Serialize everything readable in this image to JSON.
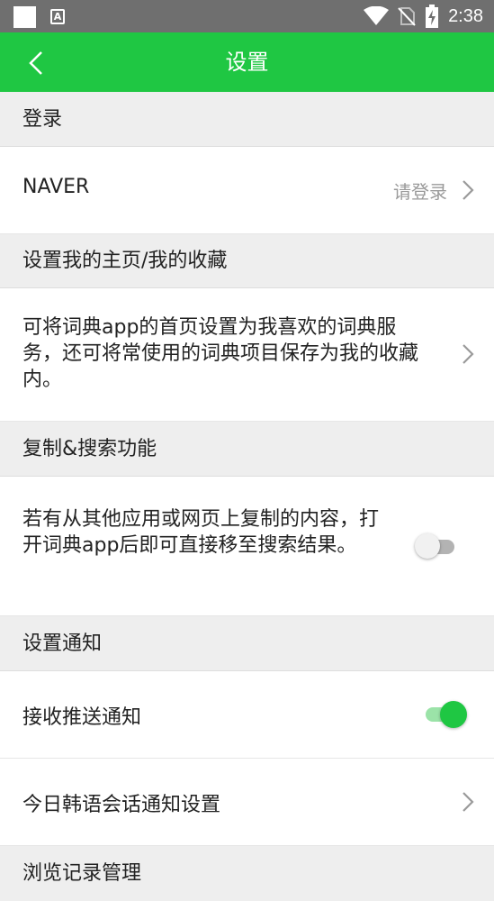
{
  "status_bar": {
    "time": "2:38",
    "icons": [
      "notification-square-icon",
      "a-icon",
      "wifi-icon",
      "no-sim-icon",
      "battery-charging-icon"
    ]
  },
  "app_bar": {
    "title": "设置",
    "back_icon": "chevron-left-icon",
    "color": "#1fc743"
  },
  "sections": {
    "login": {
      "header": "登录",
      "naver_label": "NAVER",
      "naver_value": "请登录"
    },
    "homepage": {
      "header": "设置我的主页/我的收藏",
      "description": "可将词典app的首页设置为我喜欢的词典服务，还可将常使用的词典项目保存为我的收藏内。"
    },
    "copy_search": {
      "header": "复制&搜索功能",
      "description": "若有从其他应用或网页上复制的内容，打开词典app后即可直接移至搜索结果。",
      "enabled": false
    },
    "notifications": {
      "header": "设置通知",
      "push_label": "接收推送通知",
      "push_enabled": true,
      "korean_label": "今日韩语会话通知设置"
    },
    "history": {
      "header": "浏览记录管理"
    }
  }
}
